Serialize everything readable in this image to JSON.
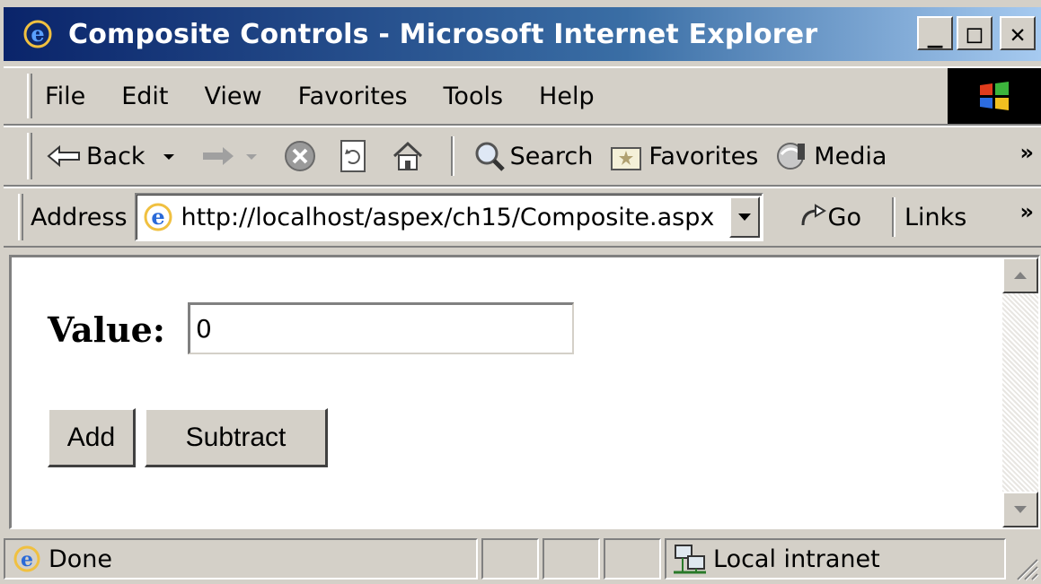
{
  "window": {
    "title": "Composite Controls - Microsoft Internet Explorer",
    "buttons": {
      "minimize": "_",
      "maximize": "□",
      "close": "✕"
    }
  },
  "menu": {
    "items": [
      "File",
      "Edit",
      "View",
      "Favorites",
      "Tools",
      "Help"
    ]
  },
  "toolbar": {
    "back_label": "Back",
    "search_label": "Search",
    "favorites_label": "Favorites",
    "media_label": "Media",
    "overflow": "»"
  },
  "address": {
    "label": "Address",
    "url": "http://localhost/aspex/ch15/Composite.aspx",
    "go_label": "Go",
    "links_label": "Links",
    "overflow": "»"
  },
  "page": {
    "value_label": "Value:",
    "value_input": "0",
    "add_button": "Add",
    "subtract_button": "Subtract"
  },
  "status": {
    "text": "Done",
    "zone": "Local intranet"
  },
  "colors": {
    "titlebar_start": "#0a246a",
    "titlebar_end": "#a6caf0",
    "chrome": "#d4d0c8"
  }
}
